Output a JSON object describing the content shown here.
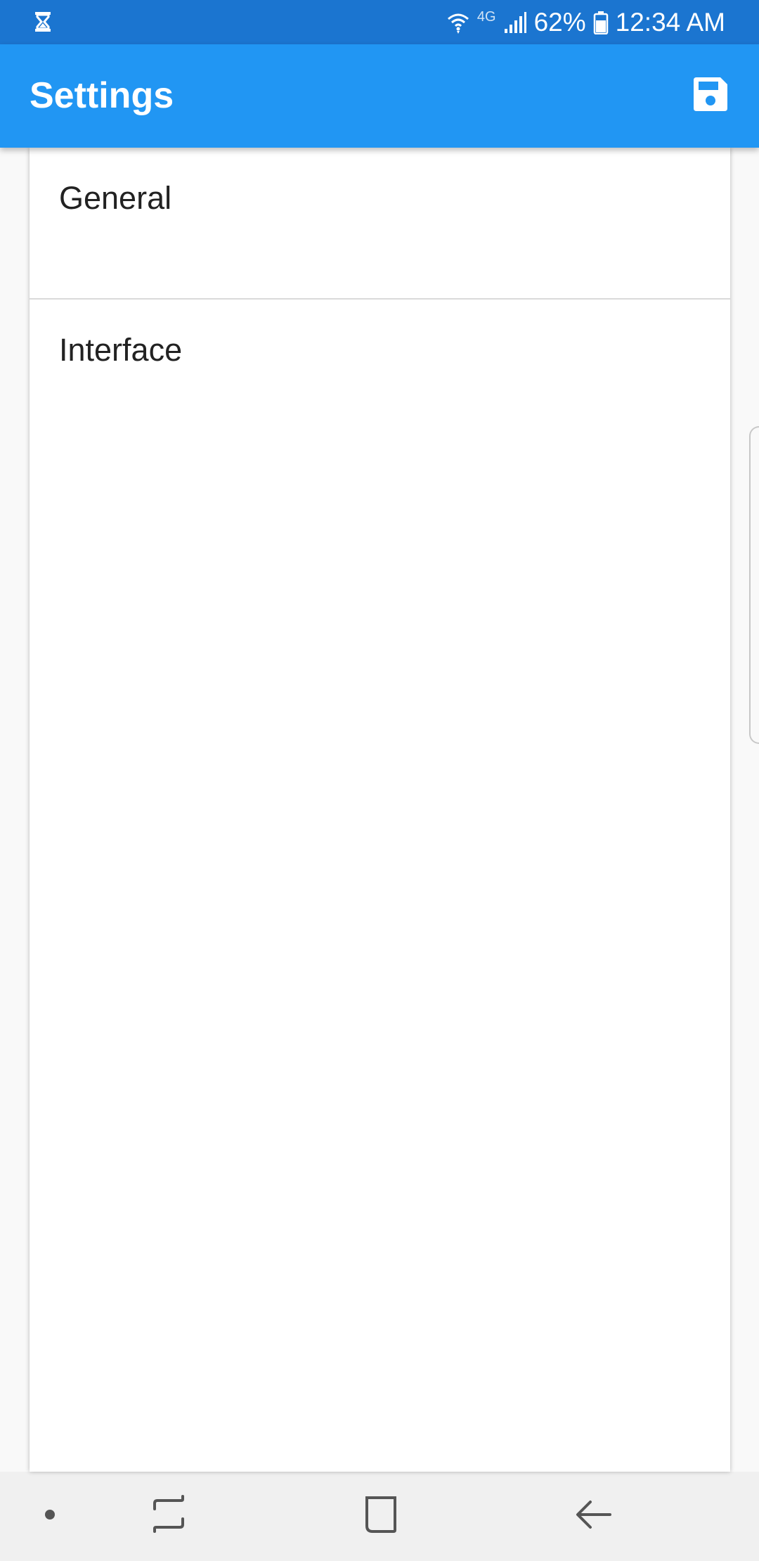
{
  "status_bar": {
    "battery_percent": "62%",
    "time": "12:34 AM",
    "network_type": "4G",
    "icons": [
      "hourglass-icon",
      "wifi-icon",
      "signal-icon",
      "battery-icon"
    ]
  },
  "app_bar": {
    "title": "Settings",
    "action_icon": "save-icon",
    "background_color": "#2196f3"
  },
  "settings": {
    "items": [
      {
        "label": "General"
      },
      {
        "label": "Interface"
      }
    ]
  },
  "nav_bar": {
    "buttons": [
      "dot-icon",
      "recents-icon",
      "home-icon",
      "back-icon"
    ]
  },
  "colors": {
    "status_bar": "#1b75d0",
    "app_bar": "#2196f3",
    "text": "#222222"
  }
}
